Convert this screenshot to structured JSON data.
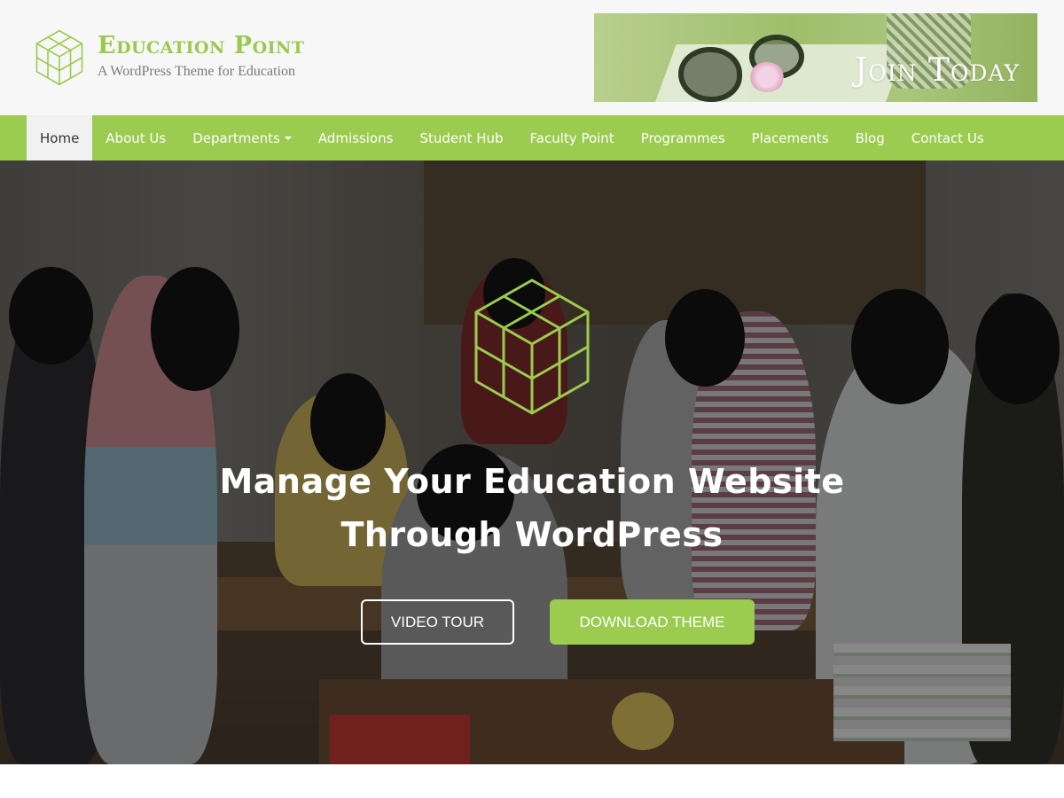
{
  "header": {
    "site_title": "Education Point",
    "tagline": "A WordPress Theme for Education",
    "logo_icon": "cube-stack-icon",
    "banner": {
      "text": "Join Today"
    }
  },
  "nav": {
    "items": [
      {
        "label": "Home",
        "active": true
      },
      {
        "label": "About Us"
      },
      {
        "label": "Departments",
        "has_dropdown": true
      },
      {
        "label": "Admissions"
      },
      {
        "label": "Student Hub"
      },
      {
        "label": "Faculty Point"
      },
      {
        "label": "Programmes"
      },
      {
        "label": "Placements"
      },
      {
        "label": "Blog"
      },
      {
        "label": "Contact Us"
      }
    ]
  },
  "hero": {
    "title_line1": "Manage Your Education Website",
    "title_line2": "Through WordPress",
    "buttons": {
      "video_tour": "VIDEO TOUR",
      "download_theme": "DOWNLOAD THEME"
    }
  },
  "colors": {
    "accent": "#9bcb4f",
    "header_bg": "#f7f7f7",
    "nav_active_bg": "#f1f1f1",
    "tagline": "#7a7a7a"
  }
}
